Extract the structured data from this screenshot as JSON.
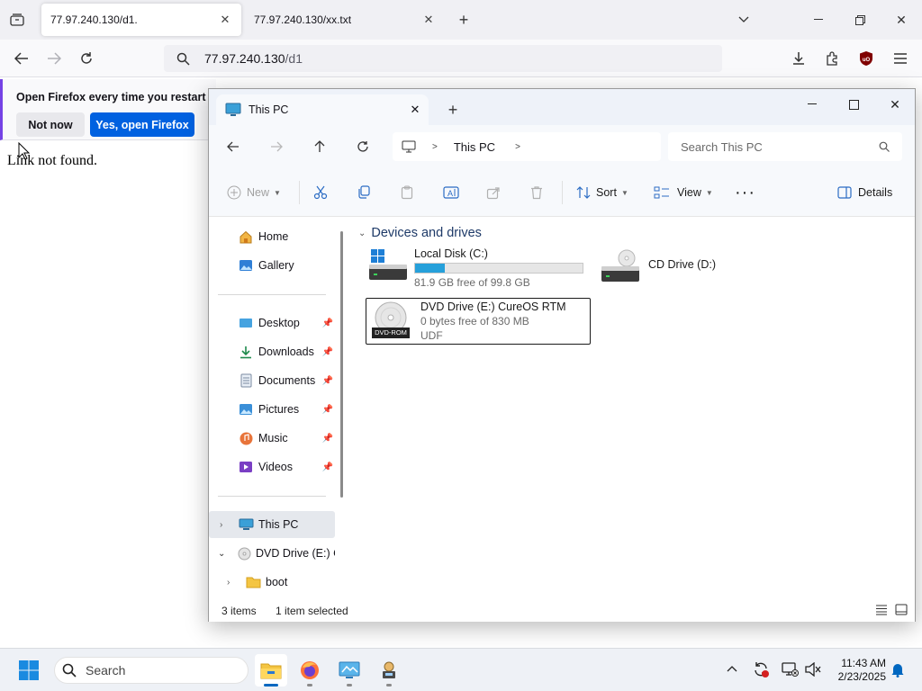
{
  "firefox": {
    "tabs": [
      {
        "title": "77.97.240.130/d1."
      },
      {
        "title": "77.97.240.130/xx.txt"
      }
    ],
    "url_host": "77.97.240.130",
    "url_path": "/d1",
    "notification": {
      "message": "Open Firefox every time you restart yo",
      "not_now": "Not now",
      "yes_open": "Yes, open Firefox"
    },
    "page_text": "Link not found."
  },
  "explorer": {
    "tab_title": "This PC",
    "breadcrumb": "This PC",
    "search_placeholder": "Search This PC",
    "commands": {
      "new": "New",
      "sort": "Sort",
      "view": "View",
      "details": "Details"
    },
    "nav": {
      "home": "Home",
      "gallery": "Gallery",
      "desktop": "Desktop",
      "downloads": "Downloads",
      "documents": "Documents",
      "pictures": "Pictures",
      "music": "Music",
      "videos": "Videos",
      "this_pc": "This PC",
      "dvd_drive": "DVD Drive (E:) C",
      "boot": "boot"
    },
    "group_title": "Devices and drives",
    "drives": {
      "c": {
        "name": "Local Disk (C:)",
        "free": "81.9 GB free of 99.8 GB",
        "used_fraction": 0.18
      },
      "d": {
        "name": "CD Drive (D:)"
      },
      "e": {
        "name": "DVD Drive (E:) CureOS RTM",
        "free": "0 bytes free of 830 MB",
        "fs": "UDF",
        "badge": "DVD-ROM"
      }
    },
    "status": {
      "items": "3 items",
      "selected": "1 item selected"
    }
  },
  "taskbar": {
    "search": "Search",
    "time": "11:43 AM",
    "date": "2/23/2025"
  },
  "colors": {
    "firefox_blue": "#0061e0",
    "progress_blue": "#26a0da",
    "win_accent": "#0067c0"
  }
}
